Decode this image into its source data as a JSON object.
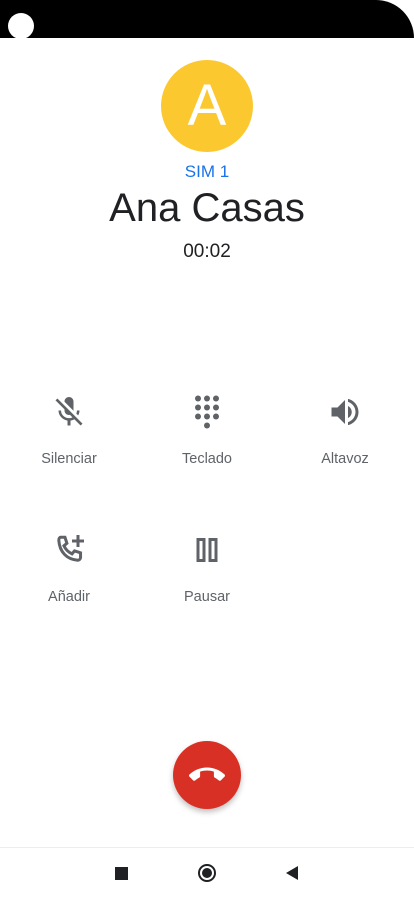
{
  "call": {
    "avatar_initial": "A",
    "sim": "SIM 1",
    "name": "Ana Casas",
    "duration": "00:02"
  },
  "controls": {
    "mute": {
      "label": "Silenciar",
      "icon": "mic-off-icon"
    },
    "keypad": {
      "label": "Teclado",
      "icon": "dialpad-icon"
    },
    "speaker": {
      "label": "Altavoz",
      "icon": "speaker-icon"
    },
    "add_call": {
      "label": "Añadir",
      "icon": "add-call-icon"
    },
    "hold": {
      "label": "Pausar",
      "icon": "pause-icon"
    }
  },
  "end_call": {
    "icon": "hang-up-icon"
  },
  "nav": {
    "recents": "square-icon",
    "home": "circle-icon",
    "back": "triangle-back-icon"
  },
  "colors": {
    "avatar": "#fbc830",
    "sim": "#1a73e8",
    "end_call": "#d93025",
    "icons": "#5f6368"
  }
}
